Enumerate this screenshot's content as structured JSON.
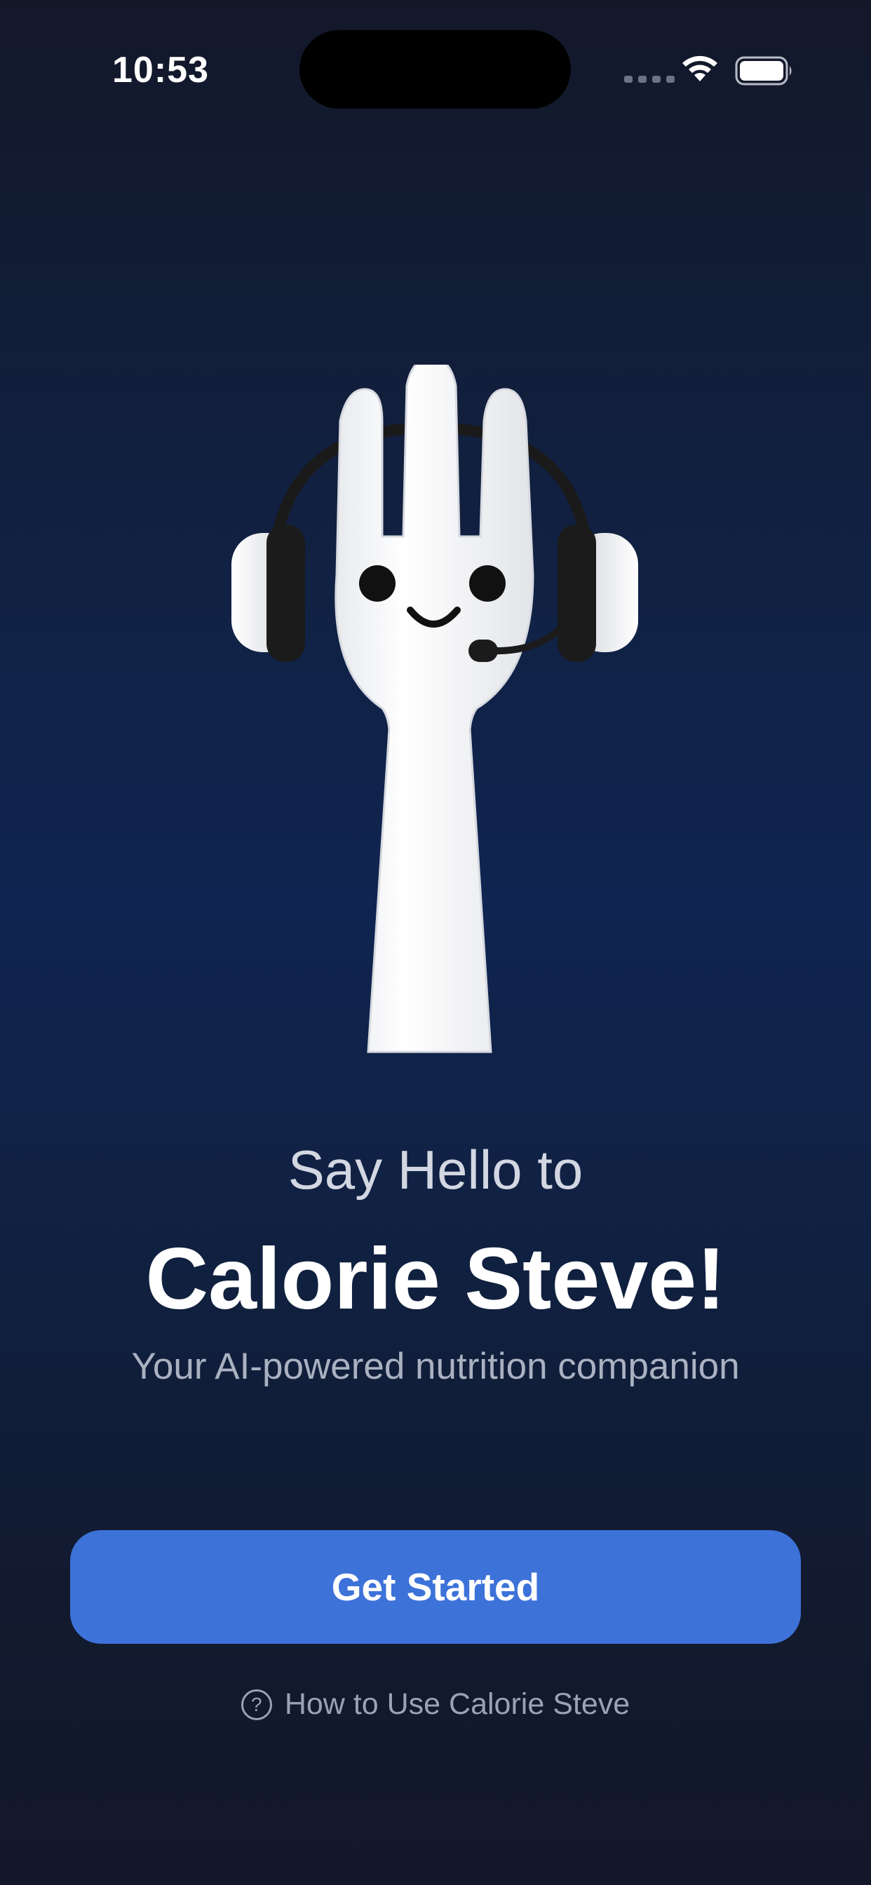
{
  "status_bar": {
    "time": "10:53"
  },
  "onboarding": {
    "greeting": "Say Hello to",
    "title": "Calorie Steve!",
    "subtitle": "Your AI-powered nutrition companion",
    "primary_button_label": "Get Started",
    "help_link_label": "How to Use Calorie Steve",
    "help_icon_glyph": "?"
  },
  "icons": {
    "wifi": "wifi-icon",
    "battery": "battery-icon",
    "signal": "cellular-signal-icon",
    "help": "question-circle-icon",
    "mascot": "fork-mascot-with-headset"
  },
  "colors": {
    "accent": "#3D72D9",
    "background_top": "#131829",
    "background_mid": "#0F2450",
    "text_primary": "#FFFFFF",
    "text_secondary": "#AAB1C1"
  }
}
